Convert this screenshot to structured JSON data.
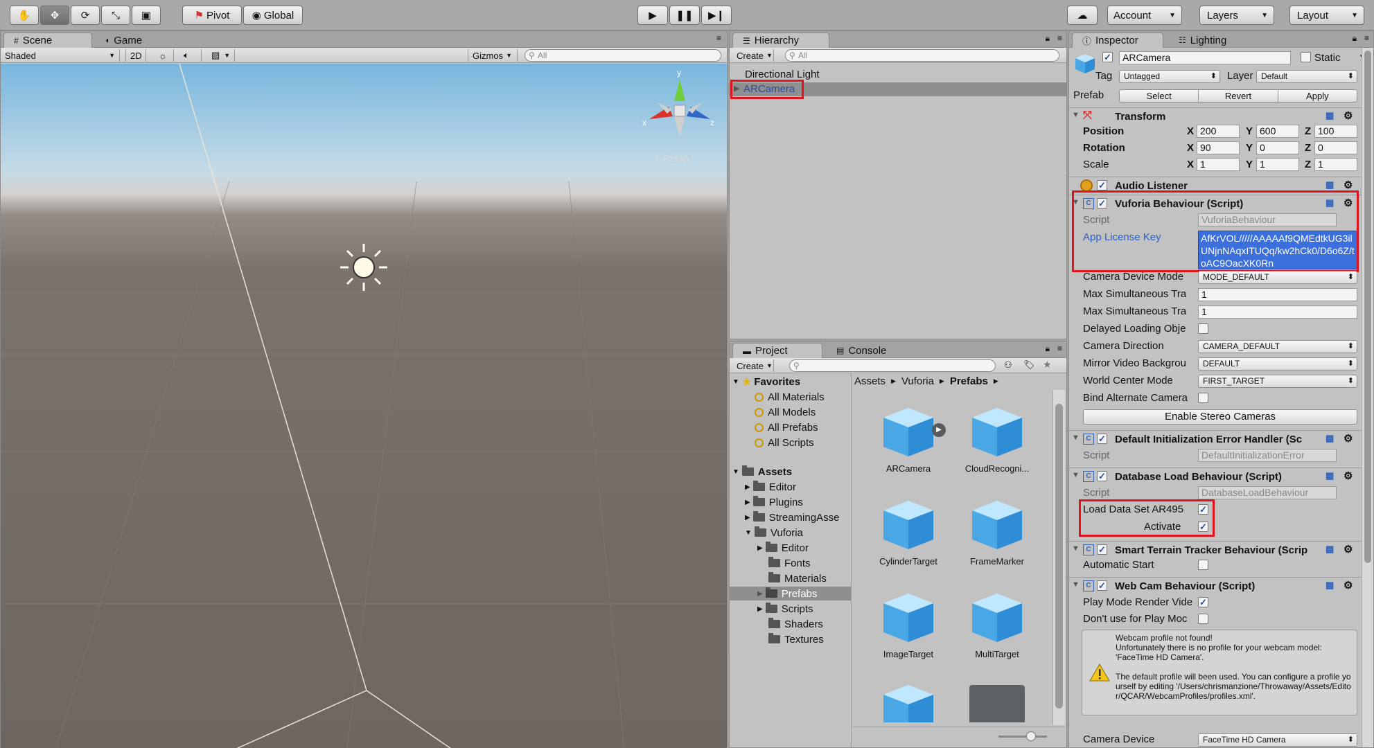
{
  "toolbar": {
    "pivot": "Pivot",
    "global": "Global",
    "account": "Account",
    "layers": "Layers",
    "layout": "Layout"
  },
  "scene": {
    "tab_scene": "Scene",
    "tab_game": "Game",
    "shading": "Shaded",
    "mode_2d": "2D",
    "gizmos": "Gizmos",
    "search_placeholder": "All",
    "persp_label": "< Persp",
    "axis_y": "y",
    "axis_x": "x",
    "axis_z": "z"
  },
  "hierarchy": {
    "title": "Hierarchy",
    "create": "Create",
    "search_placeholder": "All",
    "items": [
      "Directional Light",
      "ARCamera"
    ]
  },
  "project": {
    "tab_project": "Project",
    "tab_console": "Console",
    "create": "Create",
    "favorites_label": "Favorites",
    "favorites": [
      "All Materials",
      "All Models",
      "All Prefabs",
      "All Scripts"
    ],
    "assets_label": "Assets",
    "asset_folders": [
      "Editor",
      "Plugins",
      "StreamingAsse",
      "Vuforia"
    ],
    "vuforia_folders": [
      "Editor",
      "Fonts",
      "Materials",
      "Prefabs",
      "Scripts",
      "Shaders",
      "Textures"
    ],
    "breadcrumb": [
      "Assets",
      "Vuforia",
      "Prefabs"
    ],
    "prefabs": [
      "ARCamera",
      "CloudRecogni...",
      "CylinderTarget",
      "FrameMarker",
      "ImageTarget",
      "MultiTarget"
    ]
  },
  "inspector": {
    "tab_inspector": "Inspector",
    "tab_lighting": "Lighting",
    "object_name": "ARCamera",
    "static_label": "Static",
    "tag_label": "Tag",
    "tag_value": "Untagged",
    "layer_label": "Layer",
    "layer_value": "Default",
    "prefab_label": "Prefab",
    "prefab_select": "Select",
    "prefab_revert": "Revert",
    "prefab_apply": "Apply",
    "transform": {
      "title": "Transform",
      "position_label": "Position",
      "rotation_label": "Rotation",
      "scale_label": "Scale",
      "x": "X",
      "y": "Y",
      "z": "Z",
      "position": [
        "200",
        "600",
        "100"
      ],
      "rotation": [
        "90",
        "0",
        "0"
      ],
      "scale": [
        "1",
        "1",
        "1"
      ]
    },
    "audio_listener": "Audio Listener",
    "vuforia": {
      "title": "Vuforia Behaviour (Script)",
      "script_label": "Script",
      "script_value": "VuforiaBehaviour",
      "license_label": "App License Key",
      "license_value": "AfKrVOL/////AAAAAf9QMEdtkUG3ilUNjnNAqxITUQq/kw2hCk0/D6o6Z/toAC9OacXK0Rn",
      "camera_device_mode_label": "Camera Device Mode",
      "camera_device_mode_value": "MODE_DEFAULT",
      "max_sim_1_label": "Max Simultaneous Tra",
      "max_sim_1_value": "1",
      "max_sim_2_label": "Max Simultaneous Tra",
      "max_sim_2_value": "1",
      "delayed_label": "Delayed Loading Obje",
      "camera_direction_label": "Camera Direction",
      "camera_direction_value": "CAMERA_DEFAULT",
      "mirror_label": "Mirror Video Backgrou",
      "mirror_value": "DEFAULT",
      "world_center_label": "World Center Mode",
      "world_center_value": "FIRST_TARGET",
      "bind_alt_label": "Bind Alternate Camera",
      "stereo_button": "Enable Stereo Cameras"
    },
    "default_init": {
      "title": "Default Initialization Error Handler (Sc",
      "script_label": "Script",
      "script_value": "DefaultInitializationError"
    },
    "database_load": {
      "title": "Database Load Behaviour (Script)",
      "script_label": "Script",
      "script_value": "DatabaseLoadBehaviour",
      "load_label": "Load Data Set AR495",
      "activate_label": "Activate"
    },
    "smart_terrain": {
      "title": "Smart Terrain Tracker Behaviour (Scrip",
      "auto_start_label": "Automatic Start"
    },
    "webcam": {
      "title": "Web Cam Behaviour (Script)",
      "play_mode_label": "Play Mode Render Vide",
      "dont_use_label": "Don't use for Play Moc",
      "warning_1": "Webcam profile not found!",
      "warning_2": "Unfortunately there is no profile for your webcam model: 'FaceTime HD Camera'.",
      "warning_3": "The default profile will been used. You can configure a profile yourself by editing '/Users/chrismanzione/Throwaway/Assets/Editor/QCAR/WebcamProfiles/profiles.xml'.",
      "camera_device_label": "Camera Device",
      "camera_device_value": "FaceTime HD Camera"
    }
  }
}
